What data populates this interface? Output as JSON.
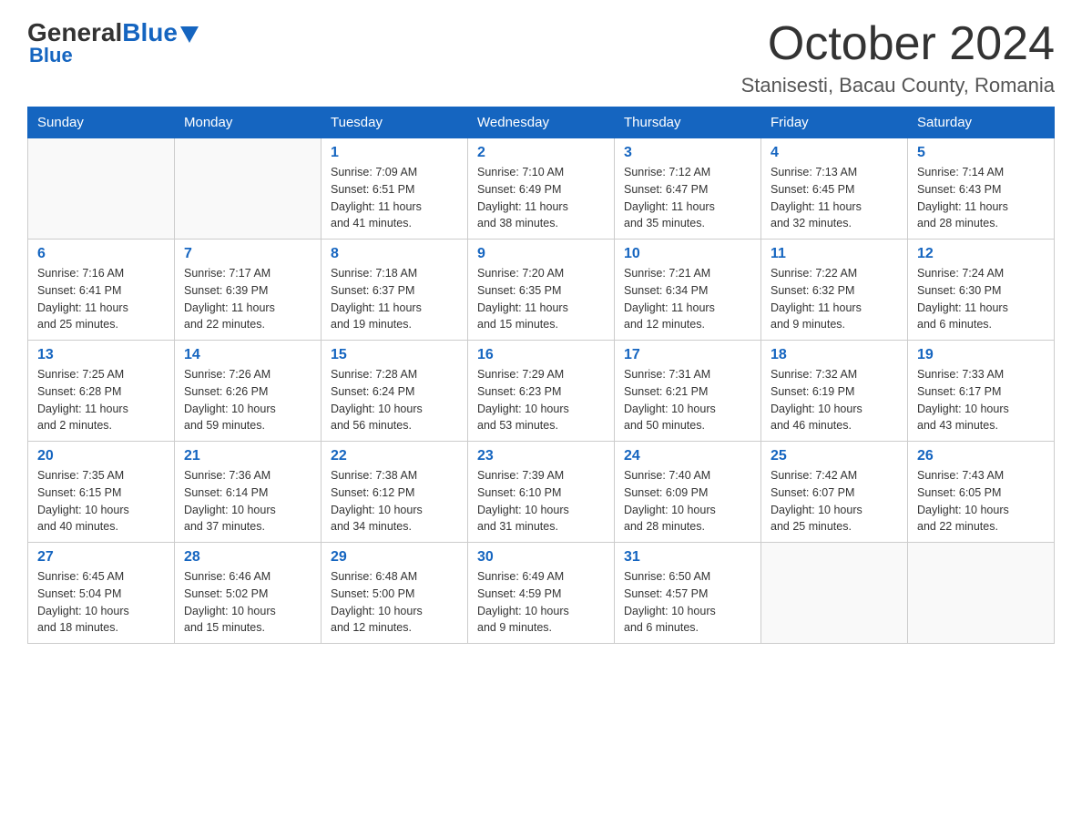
{
  "header": {
    "logo_general": "General",
    "logo_blue": "Blue",
    "month_title": "October 2024",
    "location": "Stanisesti, Bacau County, Romania"
  },
  "days_of_week": [
    "Sunday",
    "Monday",
    "Tuesday",
    "Wednesday",
    "Thursday",
    "Friday",
    "Saturday"
  ],
  "weeks": [
    [
      {
        "day": "",
        "info": ""
      },
      {
        "day": "",
        "info": ""
      },
      {
        "day": "1",
        "info": "Sunrise: 7:09 AM\nSunset: 6:51 PM\nDaylight: 11 hours\nand 41 minutes."
      },
      {
        "day": "2",
        "info": "Sunrise: 7:10 AM\nSunset: 6:49 PM\nDaylight: 11 hours\nand 38 minutes."
      },
      {
        "day": "3",
        "info": "Sunrise: 7:12 AM\nSunset: 6:47 PM\nDaylight: 11 hours\nand 35 minutes."
      },
      {
        "day": "4",
        "info": "Sunrise: 7:13 AM\nSunset: 6:45 PM\nDaylight: 11 hours\nand 32 minutes."
      },
      {
        "day": "5",
        "info": "Sunrise: 7:14 AM\nSunset: 6:43 PM\nDaylight: 11 hours\nand 28 minutes."
      }
    ],
    [
      {
        "day": "6",
        "info": "Sunrise: 7:16 AM\nSunset: 6:41 PM\nDaylight: 11 hours\nand 25 minutes."
      },
      {
        "day": "7",
        "info": "Sunrise: 7:17 AM\nSunset: 6:39 PM\nDaylight: 11 hours\nand 22 minutes."
      },
      {
        "day": "8",
        "info": "Sunrise: 7:18 AM\nSunset: 6:37 PM\nDaylight: 11 hours\nand 19 minutes."
      },
      {
        "day": "9",
        "info": "Sunrise: 7:20 AM\nSunset: 6:35 PM\nDaylight: 11 hours\nand 15 minutes."
      },
      {
        "day": "10",
        "info": "Sunrise: 7:21 AM\nSunset: 6:34 PM\nDaylight: 11 hours\nand 12 minutes."
      },
      {
        "day": "11",
        "info": "Sunrise: 7:22 AM\nSunset: 6:32 PM\nDaylight: 11 hours\nand 9 minutes."
      },
      {
        "day": "12",
        "info": "Sunrise: 7:24 AM\nSunset: 6:30 PM\nDaylight: 11 hours\nand 6 minutes."
      }
    ],
    [
      {
        "day": "13",
        "info": "Sunrise: 7:25 AM\nSunset: 6:28 PM\nDaylight: 11 hours\nand 2 minutes."
      },
      {
        "day": "14",
        "info": "Sunrise: 7:26 AM\nSunset: 6:26 PM\nDaylight: 10 hours\nand 59 minutes."
      },
      {
        "day": "15",
        "info": "Sunrise: 7:28 AM\nSunset: 6:24 PM\nDaylight: 10 hours\nand 56 minutes."
      },
      {
        "day": "16",
        "info": "Sunrise: 7:29 AM\nSunset: 6:23 PM\nDaylight: 10 hours\nand 53 minutes."
      },
      {
        "day": "17",
        "info": "Sunrise: 7:31 AM\nSunset: 6:21 PM\nDaylight: 10 hours\nand 50 minutes."
      },
      {
        "day": "18",
        "info": "Sunrise: 7:32 AM\nSunset: 6:19 PM\nDaylight: 10 hours\nand 46 minutes."
      },
      {
        "day": "19",
        "info": "Sunrise: 7:33 AM\nSunset: 6:17 PM\nDaylight: 10 hours\nand 43 minutes."
      }
    ],
    [
      {
        "day": "20",
        "info": "Sunrise: 7:35 AM\nSunset: 6:15 PM\nDaylight: 10 hours\nand 40 minutes."
      },
      {
        "day": "21",
        "info": "Sunrise: 7:36 AM\nSunset: 6:14 PM\nDaylight: 10 hours\nand 37 minutes."
      },
      {
        "day": "22",
        "info": "Sunrise: 7:38 AM\nSunset: 6:12 PM\nDaylight: 10 hours\nand 34 minutes."
      },
      {
        "day": "23",
        "info": "Sunrise: 7:39 AM\nSunset: 6:10 PM\nDaylight: 10 hours\nand 31 minutes."
      },
      {
        "day": "24",
        "info": "Sunrise: 7:40 AM\nSunset: 6:09 PM\nDaylight: 10 hours\nand 28 minutes."
      },
      {
        "day": "25",
        "info": "Sunrise: 7:42 AM\nSunset: 6:07 PM\nDaylight: 10 hours\nand 25 minutes."
      },
      {
        "day": "26",
        "info": "Sunrise: 7:43 AM\nSunset: 6:05 PM\nDaylight: 10 hours\nand 22 minutes."
      }
    ],
    [
      {
        "day": "27",
        "info": "Sunrise: 6:45 AM\nSunset: 5:04 PM\nDaylight: 10 hours\nand 18 minutes."
      },
      {
        "day": "28",
        "info": "Sunrise: 6:46 AM\nSunset: 5:02 PM\nDaylight: 10 hours\nand 15 minutes."
      },
      {
        "day": "29",
        "info": "Sunrise: 6:48 AM\nSunset: 5:00 PM\nDaylight: 10 hours\nand 12 minutes."
      },
      {
        "day": "30",
        "info": "Sunrise: 6:49 AM\nSunset: 4:59 PM\nDaylight: 10 hours\nand 9 minutes."
      },
      {
        "day": "31",
        "info": "Sunrise: 6:50 AM\nSunset: 4:57 PM\nDaylight: 10 hours\nand 6 minutes."
      },
      {
        "day": "",
        "info": ""
      },
      {
        "day": "",
        "info": ""
      }
    ]
  ]
}
